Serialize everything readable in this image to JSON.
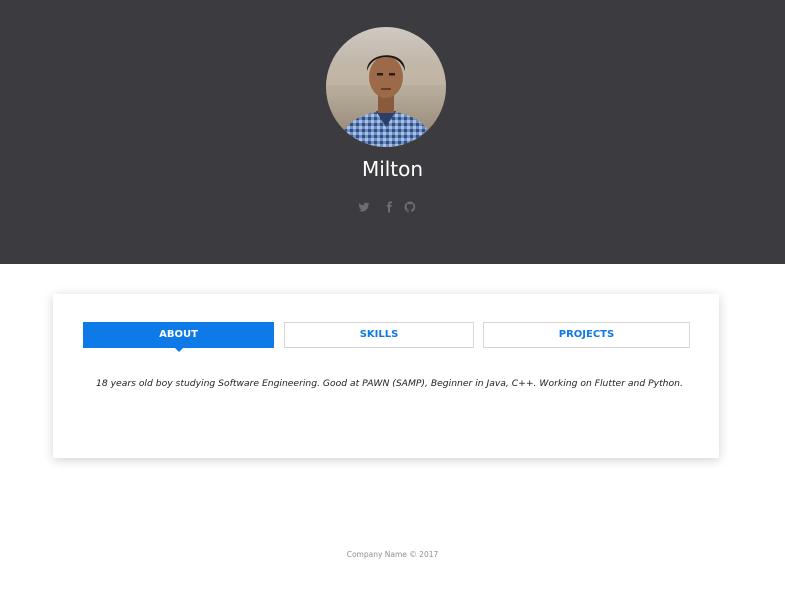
{
  "profile": {
    "name": "Milton"
  },
  "socials": [
    {
      "icon": "twitter-icon"
    },
    {
      "icon": "facebook-icon"
    },
    {
      "icon": "github-icon"
    }
  ],
  "tabs": [
    {
      "label": "ABOUT",
      "active": true
    },
    {
      "label": "SKILLS",
      "active": false
    },
    {
      "label": "PROJECTS",
      "active": false
    }
  ],
  "about": {
    "text": "18 years old boy studying Software Engineering. Good at PAWN (SAMP), Beginner in Java, C++. Working on Flutter and Python."
  },
  "footer": {
    "text": "Company Name © 2017"
  },
  "colors": {
    "header_bg": "#3c3c40",
    "accent": "#0d7ae8",
    "social_icon": "#6e6e72"
  }
}
